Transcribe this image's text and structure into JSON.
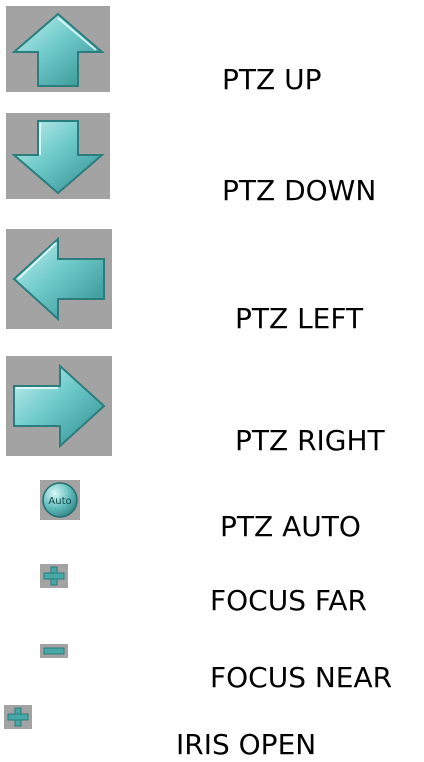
{
  "legend": {
    "items": [
      {
        "icon": "arrow-up-icon",
        "label": "PTZ UP"
      },
      {
        "icon": "arrow-down-icon",
        "label": "PTZ DOWN"
      },
      {
        "icon": "arrow-left-icon",
        "label": "PTZ LEFT"
      },
      {
        "icon": "arrow-right-icon",
        "label": "PTZ RIGHT"
      },
      {
        "icon": "auto-icon",
        "label": "PTZ AUTO",
        "icon_text": "Auto"
      },
      {
        "icon": "plus-icon",
        "label": "FOCUS FAR"
      },
      {
        "icon": "minus-icon",
        "label": "FOCUS NEAR"
      },
      {
        "icon": "plus-icon",
        "label": "IRIS OPEN"
      }
    ]
  },
  "colors": {
    "tile_background": "#a3a3a3",
    "arrow_teal": "#5fc1c1",
    "small_icon_teal": "#48a7a7",
    "text": "#000000"
  }
}
